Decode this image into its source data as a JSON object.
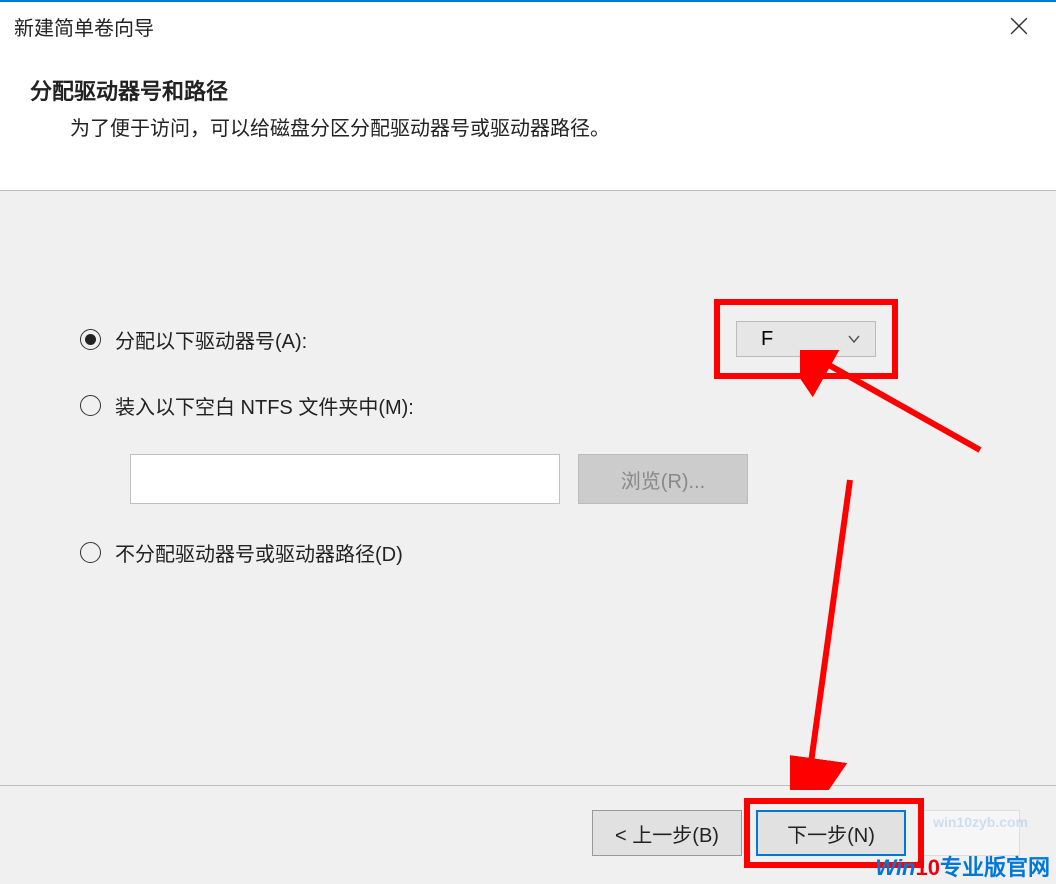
{
  "window": {
    "title": "新建简单卷向导"
  },
  "header": {
    "title": "分配驱动器号和路径",
    "subtitle": "为了便于访问，可以给磁盘分区分配驱动器号或驱动器路径。"
  },
  "options": {
    "assign": {
      "label": "分配以下驱动器号(A):",
      "selected": true,
      "drive_letter": "F"
    },
    "mount": {
      "label": "装入以下空白 NTFS 文件夹中(M):",
      "selected": false,
      "folder_path": "",
      "browse_label": "浏览(R)..."
    },
    "none": {
      "label": "不分配驱动器号或驱动器路径(D)",
      "selected": false
    }
  },
  "footer": {
    "back": "< 上一步(B)",
    "next": "下一步(N)",
    "cancel": ""
  },
  "watermark": {
    "small": "win10zyb.com",
    "big_prefix": "Win",
    "big_digits": "10",
    "big_suffix": "专业版官网"
  },
  "annotations": {
    "highlight_color": "#ff0000"
  }
}
